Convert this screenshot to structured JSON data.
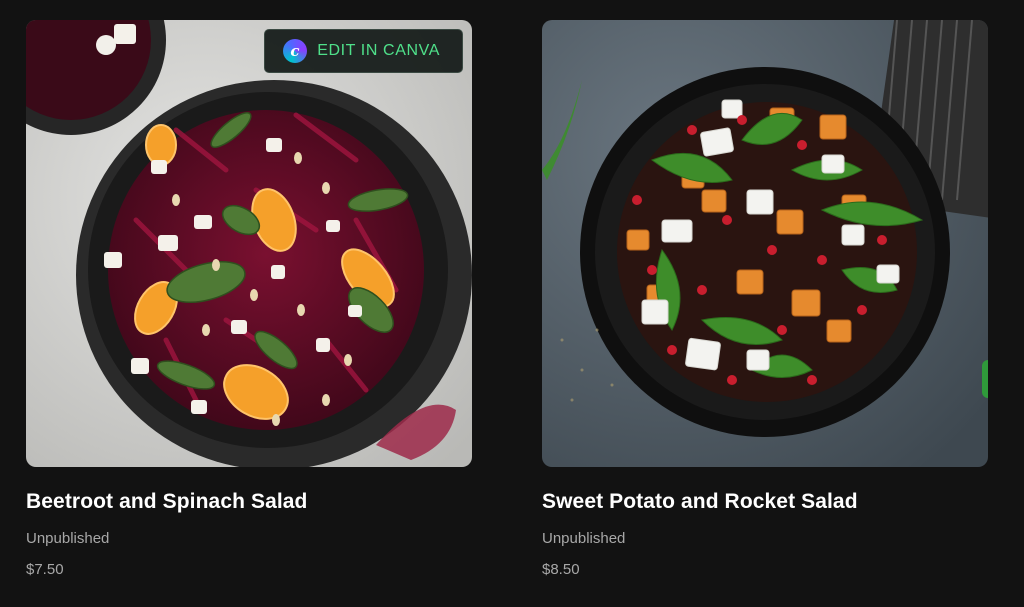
{
  "products": [
    {
      "title": "Beetroot and Spinach Salad",
      "status": "Unpublished",
      "price": "$7.50",
      "image_alt": "Beetroot and spinach salad in a dark bowl",
      "edit_button_label": "EDIT IN CANVA",
      "edit_button_icon": "canva-logo-icon"
    },
    {
      "title": "Sweet Potato and Rocket Salad",
      "status": "Unpublished",
      "price": "$8.50",
      "image_alt": "Sweet potato and rocket salad in a black bowl"
    }
  ],
  "colors": {
    "page_background": "#121212",
    "title_text": "#ffffff",
    "meta_text": "#a8a8a8",
    "canva_button_text": "#4fe08a"
  }
}
